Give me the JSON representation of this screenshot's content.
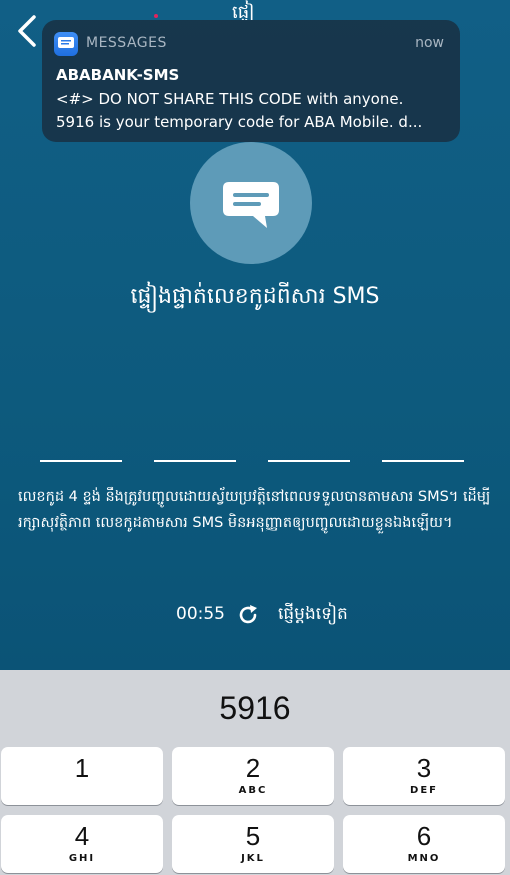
{
  "header": {
    "back_icon": "chevron-left-icon",
    "title_peek": "ផ្ទៀ"
  },
  "notification": {
    "app_name": "MESSAGES",
    "time": "now",
    "sender": "ABABANK-SMS",
    "line1": "<#> DO NOT SHARE THIS CODE with anyone.",
    "line2": "5916 is your temporary code for ABA Mobile. d..."
  },
  "main": {
    "heading": "ផ្ទៀងផ្ទាត់លេខកូដពីសារ SMS",
    "otp_slots": [
      "",
      "",
      "",
      ""
    ],
    "description": "លេខកូដ 4 ខ្ទង់ នឹងត្រូវបញ្ចូលដោយស្វ័យប្រវត្តិនៅពេលទទួលបានតាមសារ SMS។ ដើម្បីរក្សាសុវត្ថិភាព លេខកូដតាមសារ SMS មិនអនុញ្ញាតឲ្យបញ្ចូលដោយខ្លួនឯងឡើយ។",
    "timer": "00:55",
    "resend": "ផ្ញើម្តងទៀត"
  },
  "keyboard": {
    "suggestion": "5916",
    "keys": [
      {
        "num": "1",
        "letters": ""
      },
      {
        "num": "2",
        "letters": "ABC"
      },
      {
        "num": "3",
        "letters": "DEF"
      },
      {
        "num": "4",
        "letters": "GHI"
      },
      {
        "num": "5",
        "letters": "JKL"
      },
      {
        "num": "6",
        "letters": "MNO"
      }
    ]
  }
}
